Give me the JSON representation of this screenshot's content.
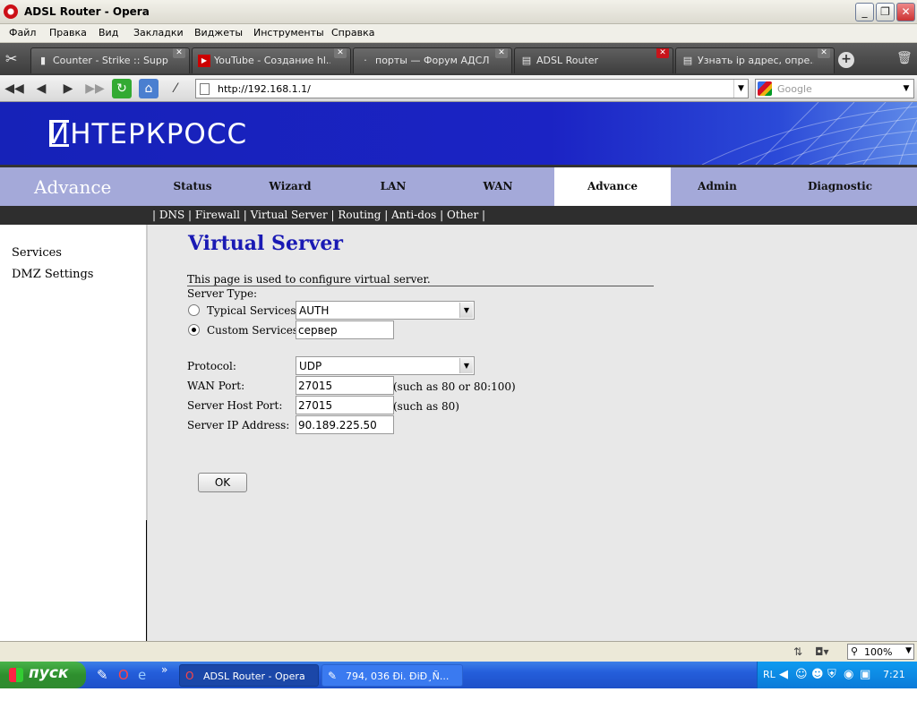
{
  "window": {
    "title": "ADSL Router - Opera"
  },
  "menu": [
    "Файл",
    "Правка",
    "Вид",
    "Закладки",
    "Виджеты",
    "Инструменты",
    "Справка"
  ],
  "tabs": [
    {
      "label": "Counter - Strike :: Supp...",
      "icon": "cs-icon"
    },
    {
      "label": "YouTube - Создание hl...",
      "icon": "youtube-icon"
    },
    {
      "label": "порты — Форум АДСЛ ...",
      "icon": "forum-icon"
    },
    {
      "label": "ADSL Router",
      "icon": "page-icon"
    },
    {
      "label": "Узнать ip адрес, опре...",
      "icon": "page-icon"
    }
  ],
  "address": {
    "url": "http://192.168.1.1/",
    "search_placeholder": "Google"
  },
  "page": {
    "logo": "ИНТЕРКРОСС",
    "section_title": "Advance",
    "nav": [
      "Status",
      "Wizard",
      "LAN",
      "WAN",
      "Advance",
      "Admin",
      "Diagnostic"
    ],
    "subnav": "| DNS | Firewall | Virtual Server | Routing | Anti-dos | Other |",
    "sidebar": [
      "Services",
      "DMZ Settings"
    ],
    "heading": "Virtual Server",
    "description": "This page is used to configure virtual server.",
    "server_type_label": "Server Type:",
    "typical_label": "Typical Services:",
    "typical_value": "AUTH",
    "custom_label": "Custom Services:",
    "custom_value": "сервер",
    "protocol_label": "Protocol:",
    "protocol_value": "UDP",
    "wan_port_label": "WAN Port:",
    "wan_port_value": "27015",
    "wan_port_hint": "(such as 80 or 80:100)",
    "host_port_label": "Server Host Port:",
    "host_port_value": "27015",
    "host_port_hint": "(such as 80)",
    "ip_label": "Server IP Address:",
    "ip_value": "90.189.225.50",
    "ok_label": "OK"
  },
  "statusbar": {
    "zoom": "100%"
  },
  "taskbar": {
    "start_label": "пуск",
    "items": [
      {
        "label": "ADSL Router - Opera",
        "icon": "opera-icon"
      },
      {
        "label": "794, 036 Đi. ĐiĐ¸Ñ...",
        "icon": "notepad-icon"
      }
    ],
    "lang": "RL",
    "clock": "7:21"
  }
}
